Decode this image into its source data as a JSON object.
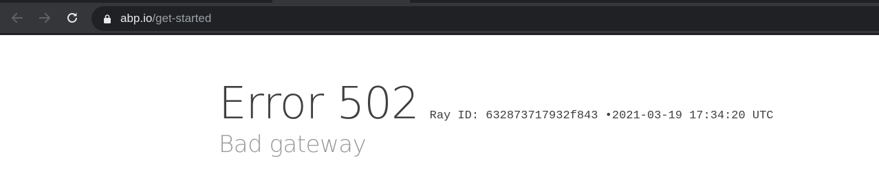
{
  "browser": {
    "url_host": "abp.io",
    "url_path": "/get-started",
    "icons": {
      "back": "arrow-left-icon",
      "forward": "arrow-right-icon",
      "reload": "reload-icon",
      "lock": "lock-icon"
    },
    "colors": {
      "toolbar": "#35363a",
      "omnibox": "#202124",
      "icon": "#9aa0a6",
      "icon_active": "#e8eaed"
    }
  },
  "page": {
    "error_title": "Error 502",
    "ray_id": "Ray ID: 632873717932f843",
    "separator": "•",
    "timestamp": "2021-03-19 17:34:20 UTC",
    "subtitle": "Bad gateway",
    "colors": {
      "title": "#404040",
      "subtitle": "#999999"
    }
  }
}
